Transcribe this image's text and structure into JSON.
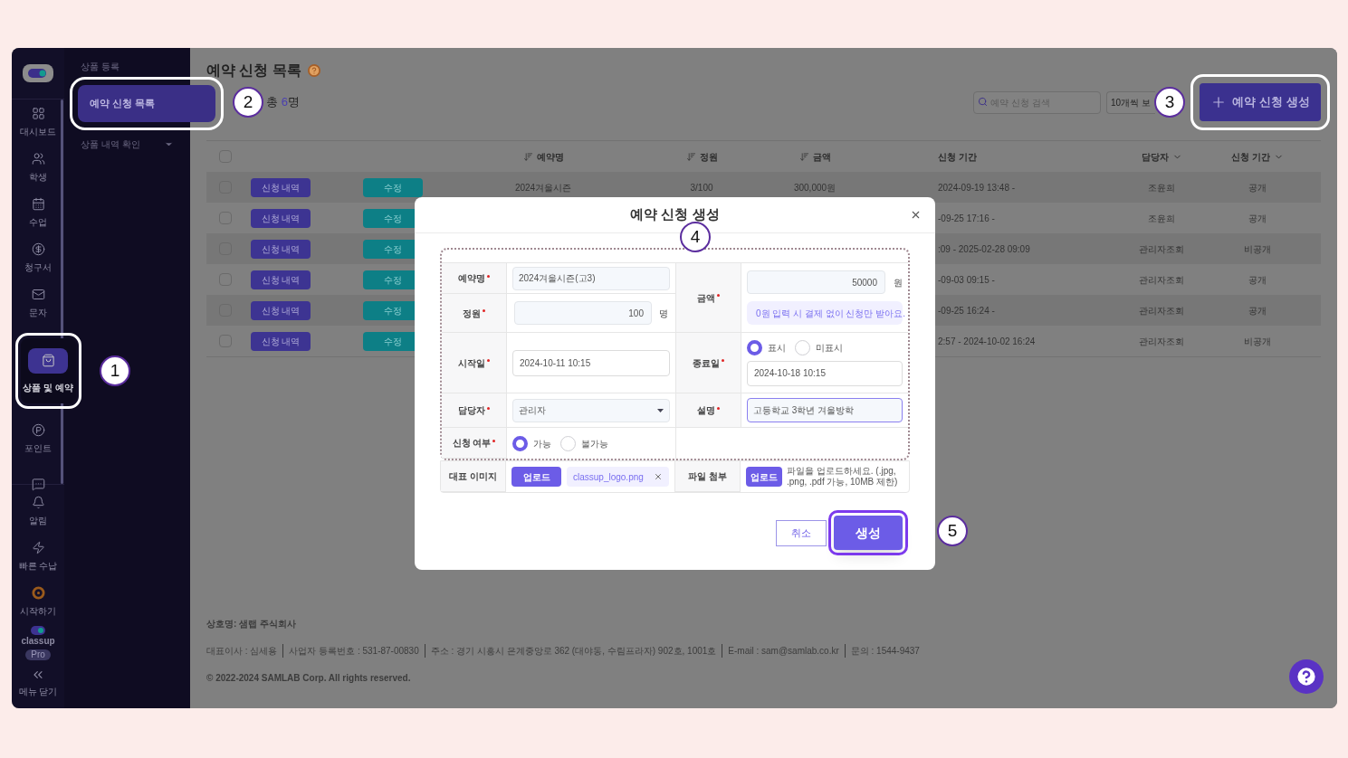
{
  "sidebar": {
    "nav_items": [
      {
        "label": "대시보드",
        "selected": false
      },
      {
        "label": "학생",
        "selected": false
      },
      {
        "label": "수업",
        "selected": false
      },
      {
        "label": "청구서",
        "selected": false
      },
      {
        "label": "문자",
        "selected": false
      },
      {
        "label": "상품 및 예약",
        "selected": true
      },
      {
        "label": "포인트",
        "selected": false
      },
      {
        "selected": false
      }
    ],
    "bottom_items": [
      {
        "label": "알림"
      },
      {
        "label": "빠른 수납"
      },
      {
        "label": "시작하기"
      }
    ],
    "brand": {
      "name": "classup",
      "badge": "Pro"
    },
    "collapse": "메뉴 닫기"
  },
  "submenu": {
    "section": "상품 등록",
    "items": [
      {
        "label": "예약 신청 목록",
        "selected": true,
        "expandable": false
      },
      {
        "label": "상품 내역 확인",
        "selected": false,
        "expandable": true
      }
    ]
  },
  "page": {
    "title": "예약 신청 목록",
    "total_prefix": "총",
    "total_count": "6",
    "total_suffix": "명",
    "search": {
      "placeholder": "예약 신청 검색"
    },
    "page_size": "10개씩 보",
    "create_button": "예약 신청 생성"
  },
  "table": {
    "select_all": {
      "checked": false
    },
    "columns": [
      {
        "label": "예약명",
        "kind": "sort"
      },
      {
        "label": "정원",
        "kind": "sort"
      },
      {
        "label": "금액",
        "kind": "sort"
      },
      {
        "label": "신청 기간",
        "kind": "plain"
      },
      {
        "label": "담당자",
        "kind": "filter"
      },
      {
        "label": "신청 기간",
        "kind": "filter"
      }
    ],
    "rows": [
      {
        "checked": false,
        "detail_button": "신청 내역",
        "edit_button": "수정",
        "name": "2024겨울시즌",
        "capacity": "3/100",
        "amount": "300,000원",
        "period": "2024-09-19 13:48 -",
        "manager": "조윤희",
        "visibility": "공개"
      },
      {
        "checked": false,
        "detail_button": "신청 내역",
        "edit_button": "수정",
        "period": "-09-25 17:16 -",
        "manager": "조윤희",
        "visibility": "공개"
      },
      {
        "checked": false,
        "detail_button": "신청 내역",
        "edit_button": "수정",
        "period": ":09 - 2025-02-28 09:09",
        "manager": "관리자조회",
        "visibility": "비공개"
      },
      {
        "checked": false,
        "detail_button": "신청 내역",
        "edit_button": "수정",
        "period": "-09-03 09:15 -",
        "manager": "관리자조회",
        "visibility": "공개"
      },
      {
        "checked": false,
        "detail_button": "신청 내역",
        "edit_button": "수정",
        "period": "-09-25 16:24 -",
        "manager": "관리자조회",
        "visibility": "공개"
      },
      {
        "checked": false,
        "detail_button": "신청 내역",
        "edit_button": "수정",
        "period": "2:57 - 2024-10-02 16:24",
        "manager": "관리자조회",
        "visibility": "비공개"
      }
    ]
  },
  "footer": {
    "company": "상호명: 샘랩 주식회사",
    "info": [
      "대표이사 : 심세용",
      "사업자 등록번호 : 531-87-00830",
      "주소 : 경기 시흥시 은계중앙로 362 (대야동, 수림프라자) 902호, 1001호",
      "E-mail : sam@samlab.co.kr",
      "문의 : 1544-9437"
    ],
    "copyright": "© 2022-2024 SAMLAB Corp. All rights reserved."
  },
  "modal": {
    "title": "예약 신청 생성",
    "form": {
      "name": {
        "label": "예약명",
        "required": true,
        "value": "2024겨울시즌(고3)"
      },
      "price": {
        "label": "금액",
        "required": true,
        "value": "50000",
        "unit": "원",
        "hint": "0원 입력 시 결제 없이 신청만 받아요."
      },
      "capacity": {
        "label": "정원",
        "required": true,
        "value": "100",
        "unit": "명"
      },
      "start": {
        "label": "시작일",
        "required": true,
        "value": "2024-10-11 10:15"
      },
      "end": {
        "label": "종료일",
        "required": true,
        "options": [
          {
            "label": "표시",
            "selected": true
          },
          {
            "label": "미표시",
            "selected": false
          }
        ],
        "value": "2024-10-18 10:15"
      },
      "manager": {
        "label": "담당자",
        "required": true,
        "value": "관리자"
      },
      "description": {
        "label": "설명",
        "required": true,
        "value": "고등학교 3학년 겨울방학",
        "focused": true
      },
      "open": {
        "label": "신청 여부",
        "required": true,
        "options": [
          {
            "label": "가능",
            "selected": true
          },
          {
            "label": "불가능",
            "selected": false
          }
        ]
      },
      "image": {
        "label": "대표 이미지",
        "required": false,
        "button": "업로드",
        "file": "classup_logo.png"
      },
      "attachment": {
        "label": "파일 첨부",
        "required": false,
        "button": "업로드",
        "hint": "파일을 업로드하세요. (.jpg, .png, .pdf 가능, 10MB 제한)"
      }
    },
    "cancel": "취소",
    "submit": "생성"
  },
  "annotations": [
    {
      "label": "1"
    },
    {
      "label": "2"
    },
    {
      "label": "3"
    },
    {
      "label": "4"
    },
    {
      "label": "5"
    }
  ]
}
